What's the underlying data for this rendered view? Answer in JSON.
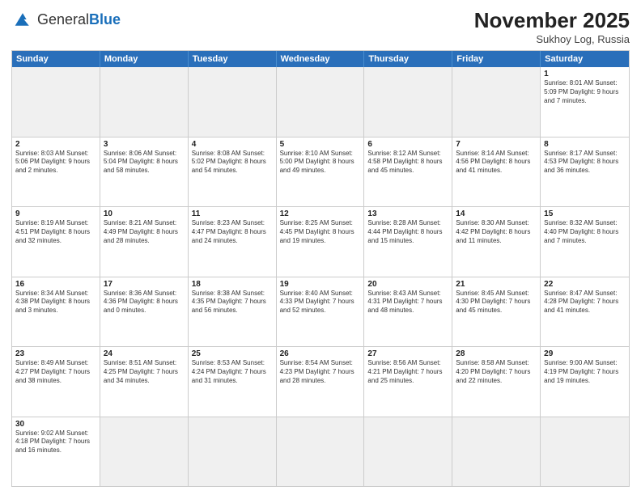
{
  "header": {
    "logo_general": "General",
    "logo_blue": "Blue",
    "month_year": "November 2025",
    "location": "Sukhoy Log, Russia"
  },
  "day_headers": [
    "Sunday",
    "Monday",
    "Tuesday",
    "Wednesday",
    "Thursday",
    "Friday",
    "Saturday"
  ],
  "weeks": [
    [
      {
        "day": "",
        "info": "",
        "empty": true
      },
      {
        "day": "",
        "info": "",
        "empty": true
      },
      {
        "day": "",
        "info": "",
        "empty": true
      },
      {
        "day": "",
        "info": "",
        "empty": true
      },
      {
        "day": "",
        "info": "",
        "empty": true
      },
      {
        "day": "",
        "info": "",
        "empty": true
      },
      {
        "day": "1",
        "info": "Sunrise: 8:01 AM\nSunset: 5:09 PM\nDaylight: 9 hours and 7 minutes.",
        "empty": false
      }
    ],
    [
      {
        "day": "2",
        "info": "Sunrise: 8:03 AM\nSunset: 5:06 PM\nDaylight: 9 hours and 2 minutes.",
        "empty": false
      },
      {
        "day": "3",
        "info": "Sunrise: 8:06 AM\nSunset: 5:04 PM\nDaylight: 8 hours and 58 minutes.",
        "empty": false
      },
      {
        "day": "4",
        "info": "Sunrise: 8:08 AM\nSunset: 5:02 PM\nDaylight: 8 hours and 54 minutes.",
        "empty": false
      },
      {
        "day": "5",
        "info": "Sunrise: 8:10 AM\nSunset: 5:00 PM\nDaylight: 8 hours and 49 minutes.",
        "empty": false
      },
      {
        "day": "6",
        "info": "Sunrise: 8:12 AM\nSunset: 4:58 PM\nDaylight: 8 hours and 45 minutes.",
        "empty": false
      },
      {
        "day": "7",
        "info": "Sunrise: 8:14 AM\nSunset: 4:56 PM\nDaylight: 8 hours and 41 minutes.",
        "empty": false
      },
      {
        "day": "8",
        "info": "Sunrise: 8:17 AM\nSunset: 4:53 PM\nDaylight: 8 hours and 36 minutes.",
        "empty": false
      }
    ],
    [
      {
        "day": "9",
        "info": "Sunrise: 8:19 AM\nSunset: 4:51 PM\nDaylight: 8 hours and 32 minutes.",
        "empty": false
      },
      {
        "day": "10",
        "info": "Sunrise: 8:21 AM\nSunset: 4:49 PM\nDaylight: 8 hours and 28 minutes.",
        "empty": false
      },
      {
        "day": "11",
        "info": "Sunrise: 8:23 AM\nSunset: 4:47 PM\nDaylight: 8 hours and 24 minutes.",
        "empty": false
      },
      {
        "day": "12",
        "info": "Sunrise: 8:25 AM\nSunset: 4:45 PM\nDaylight: 8 hours and 19 minutes.",
        "empty": false
      },
      {
        "day": "13",
        "info": "Sunrise: 8:28 AM\nSunset: 4:44 PM\nDaylight: 8 hours and 15 minutes.",
        "empty": false
      },
      {
        "day": "14",
        "info": "Sunrise: 8:30 AM\nSunset: 4:42 PM\nDaylight: 8 hours and 11 minutes.",
        "empty": false
      },
      {
        "day": "15",
        "info": "Sunrise: 8:32 AM\nSunset: 4:40 PM\nDaylight: 8 hours and 7 minutes.",
        "empty": false
      }
    ],
    [
      {
        "day": "16",
        "info": "Sunrise: 8:34 AM\nSunset: 4:38 PM\nDaylight: 8 hours and 3 minutes.",
        "empty": false
      },
      {
        "day": "17",
        "info": "Sunrise: 8:36 AM\nSunset: 4:36 PM\nDaylight: 8 hours and 0 minutes.",
        "empty": false
      },
      {
        "day": "18",
        "info": "Sunrise: 8:38 AM\nSunset: 4:35 PM\nDaylight: 7 hours and 56 minutes.",
        "empty": false
      },
      {
        "day": "19",
        "info": "Sunrise: 8:40 AM\nSunset: 4:33 PM\nDaylight: 7 hours and 52 minutes.",
        "empty": false
      },
      {
        "day": "20",
        "info": "Sunrise: 8:43 AM\nSunset: 4:31 PM\nDaylight: 7 hours and 48 minutes.",
        "empty": false
      },
      {
        "day": "21",
        "info": "Sunrise: 8:45 AM\nSunset: 4:30 PM\nDaylight: 7 hours and 45 minutes.",
        "empty": false
      },
      {
        "day": "22",
        "info": "Sunrise: 8:47 AM\nSunset: 4:28 PM\nDaylight: 7 hours and 41 minutes.",
        "empty": false
      }
    ],
    [
      {
        "day": "23",
        "info": "Sunrise: 8:49 AM\nSunset: 4:27 PM\nDaylight: 7 hours and 38 minutes.",
        "empty": false
      },
      {
        "day": "24",
        "info": "Sunrise: 8:51 AM\nSunset: 4:25 PM\nDaylight: 7 hours and 34 minutes.",
        "empty": false
      },
      {
        "day": "25",
        "info": "Sunrise: 8:53 AM\nSunset: 4:24 PM\nDaylight: 7 hours and 31 minutes.",
        "empty": false
      },
      {
        "day": "26",
        "info": "Sunrise: 8:54 AM\nSunset: 4:23 PM\nDaylight: 7 hours and 28 minutes.",
        "empty": false
      },
      {
        "day": "27",
        "info": "Sunrise: 8:56 AM\nSunset: 4:21 PM\nDaylight: 7 hours and 25 minutes.",
        "empty": false
      },
      {
        "day": "28",
        "info": "Sunrise: 8:58 AM\nSunset: 4:20 PM\nDaylight: 7 hours and 22 minutes.",
        "empty": false
      },
      {
        "day": "29",
        "info": "Sunrise: 9:00 AM\nSunset: 4:19 PM\nDaylight: 7 hours and 19 minutes.",
        "empty": false
      }
    ],
    [
      {
        "day": "30",
        "info": "Sunrise: 9:02 AM\nSunset: 4:18 PM\nDaylight: 7 hours and 16 minutes.",
        "empty": false
      },
      {
        "day": "",
        "info": "",
        "empty": true
      },
      {
        "day": "",
        "info": "",
        "empty": true
      },
      {
        "day": "",
        "info": "",
        "empty": true
      },
      {
        "day": "",
        "info": "",
        "empty": true
      },
      {
        "day": "",
        "info": "",
        "empty": true
      },
      {
        "day": "",
        "info": "",
        "empty": true
      }
    ]
  ]
}
